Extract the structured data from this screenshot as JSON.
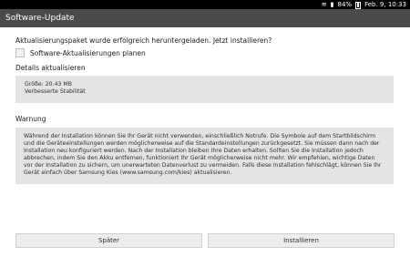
{
  "status_bar": {
    "battery": "84%",
    "datetime": "Feb. 9, 10:33",
    "icons": [
      "wifi-icon",
      "signal-icon",
      "battery-icon"
    ]
  },
  "title": "Software-Update",
  "prompt": "Aktualisierungspaket wurde erfolgreich heruntergeladen. Jetzt installieren?",
  "checkbox": {
    "label": "Software-Aktualisierungen planen",
    "checked": false
  },
  "details": {
    "heading": "Details aktualisieren",
    "size": "Größe: 20.43 MB",
    "description": "Verbesserte Stabilität"
  },
  "warning": {
    "heading": "Warnung",
    "text": "Während der Installation können Sie Ihr Gerät nicht verwenden, einschließlich Notrufe. Die Symbole auf dem Startbildschirm und die Geräteeinstellungen werden möglicherweise auf die Standardeinstellungen zurückgesetzt. Sie müssen dann nach der Installation neu konfiguriert werden. Nach der Installation bleiben Ihre Daten erhalten. Sollten Sie die Installation jedoch abbrechen, indem Sie den Akku entfernen, funktioniert Ihr Gerät möglicherweise nicht mehr. Wir empfehlen, wichtige Daten vor der Installation zu sichern, um unerwarteten Datenverlust zu vermeiden. Falls diese Installation fehlschlägt, können Sie Ihr Gerät einfach über Samsung Kies (www.samsung.com/kies) aktualisieren."
  },
  "buttons": {
    "later": "Später",
    "install": "Installieren"
  }
}
